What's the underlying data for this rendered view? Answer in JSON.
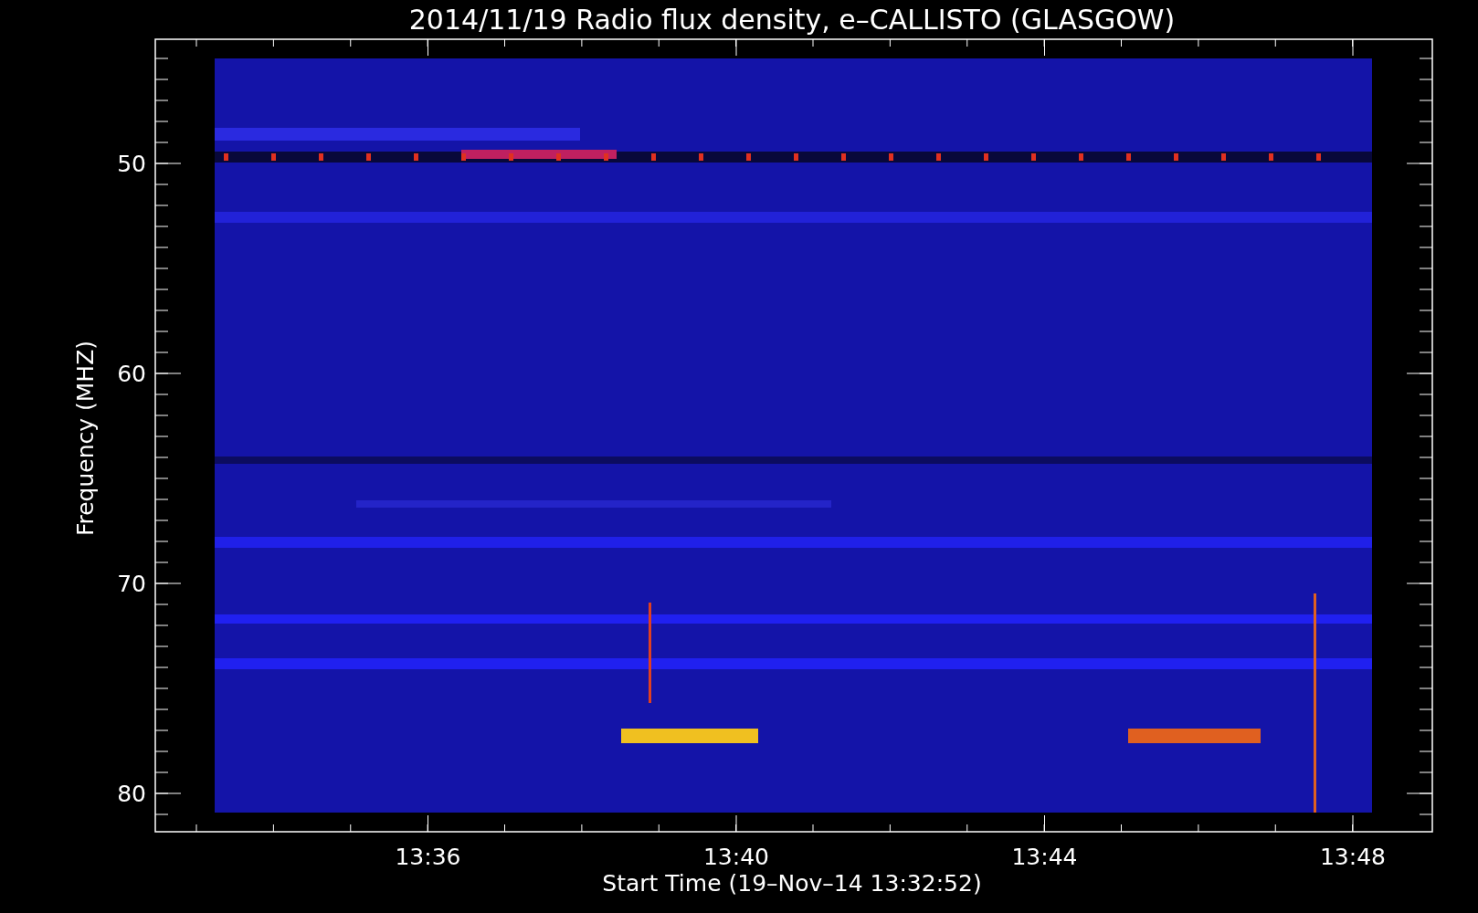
{
  "title": "2014/11/19  Radio flux density, e–CALLISTO (GLASGOW)",
  "y_axis": {
    "label": "Frequency (MHZ)",
    "ticks": [
      "50",
      "60",
      "70",
      "80"
    ]
  },
  "x_axis": {
    "label": "Start Time (19–Nov–14 13:32:52)",
    "ticks": [
      "13:36",
      "13:40",
      "13:44",
      "13:48"
    ]
  }
}
